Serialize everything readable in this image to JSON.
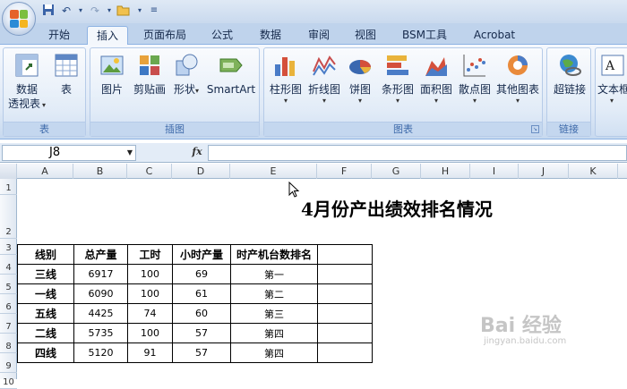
{
  "tabs": [
    "开始",
    "插入",
    "页面布局",
    "公式",
    "数据",
    "审阅",
    "视图",
    "BSM工具",
    "Acrobat"
  ],
  "ribbon": {
    "groups": {
      "table": {
        "title": "表",
        "buttons": [
          {
            "label": "数据",
            "label2": "透视表"
          },
          {
            "label": "表"
          }
        ]
      },
      "illustrations": {
        "title": "插图",
        "buttons": [
          {
            "label": "图片"
          },
          {
            "label": "剪贴画"
          },
          {
            "label": "形状"
          },
          {
            "label": "SmartArt"
          }
        ]
      },
      "charts": {
        "title": "图表",
        "buttons": [
          {
            "label": "柱形图"
          },
          {
            "label": "折线图"
          },
          {
            "label": "饼图"
          },
          {
            "label": "条形图"
          },
          {
            "label": "面积图"
          },
          {
            "label": "散点图"
          },
          {
            "label": "其他图表"
          }
        ]
      },
      "links": {
        "title": "链接",
        "buttons": [
          {
            "label": "超链接"
          }
        ]
      },
      "text": {
        "buttons": [
          {
            "label": "文本框"
          }
        ]
      }
    }
  },
  "formula_bar": {
    "name_box": "J8",
    "fx": "fx",
    "formula": ""
  },
  "columns": [
    "A",
    "B",
    "C",
    "D",
    "E",
    "F",
    "G",
    "H",
    "I",
    "J",
    "K"
  ],
  "rows": [
    "1",
    "2",
    "3",
    "4",
    "5",
    "6",
    "7",
    "8",
    "9",
    "10"
  ],
  "sheet": {
    "title": "4月份产出绩效排名情况",
    "headers": [
      "线别",
      "总产量",
      "工时",
      "小时产量",
      "时产机台数排名",
      ""
    ],
    "rows": [
      [
        "三线",
        "6917",
        "100",
        "69",
        "第一",
        ""
      ],
      [
        "一线",
        "6090",
        "100",
        "61",
        "第二",
        ""
      ],
      [
        "五线",
        "4425",
        "74",
        "60",
        "第三",
        ""
      ],
      [
        "二线",
        "5735",
        "100",
        "57",
        "第四",
        ""
      ],
      [
        "四线",
        "5120",
        "91",
        "57",
        "第四",
        ""
      ]
    ]
  },
  "watermark": {
    "text": "Bai 经验",
    "url": "jingyan.baidu.com"
  }
}
